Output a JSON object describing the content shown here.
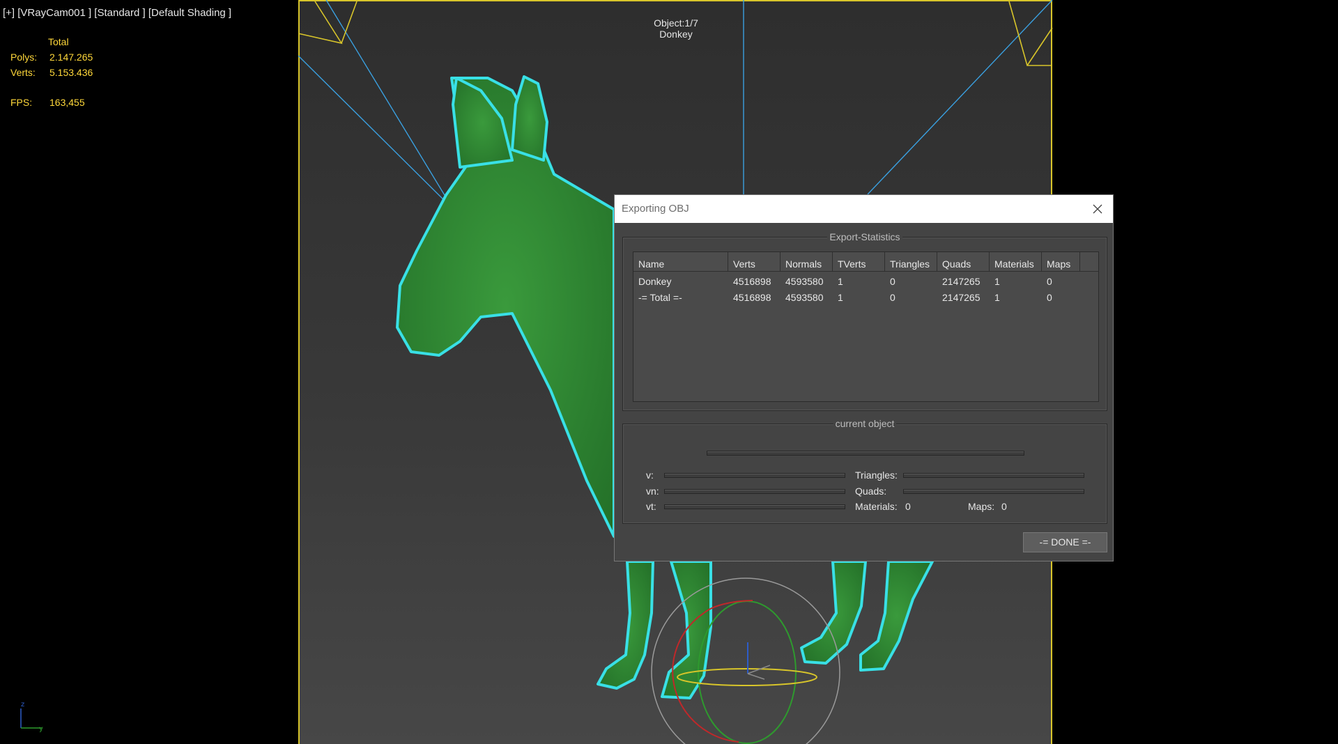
{
  "viewport": {
    "label": "[+] [VRayCam001 ] [Standard ] [Default Shading ]",
    "stats_header": "Total",
    "stats": [
      {
        "label": "Polys:",
        "value": "2.147.265"
      },
      {
        "label": "Verts:",
        "value": "5.153.436"
      },
      {
        "label": "FPS:",
        "value": "163,455"
      }
    ],
    "object_line1": "Object:1/7",
    "object_line2": "Donkey",
    "colors": {
      "frame": "#d8c52a",
      "camera_lines": "#3aa0e0",
      "mesh": "#2f8f34",
      "mesh_edge": "#39e0e6",
      "stats": "#ffd83a"
    },
    "axis_labels": {
      "z": "z",
      "y": "y"
    }
  },
  "dialog": {
    "title": "Exporting OBJ",
    "close_icon": "close-icon",
    "export_statistics": {
      "title": "Export-Statistics",
      "columns": [
        "Name",
        "Verts",
        "Normals",
        "TVerts",
        "Triangles",
        "Quads",
        "Materials",
        "Maps"
      ],
      "rows": [
        [
          "Donkey",
          "4516898",
          "4593580",
          "1",
          "0",
          "2147265",
          "1",
          "0"
        ],
        [
          "-= Total =-",
          "4516898",
          "4593580",
          "1",
          "0",
          "2147265",
          "1",
          "0"
        ]
      ]
    },
    "current_object": {
      "title": "current object",
      "v_label": "v:",
      "vn_label": "vn:",
      "vt_label": "vt:",
      "triangles_label": "Triangles:",
      "quads_label": "Quads:",
      "materials_label": "Materials:",
      "materials_value": "0",
      "maps_label": "Maps:",
      "maps_value": "0"
    },
    "done_label": "-= DONE =-"
  }
}
